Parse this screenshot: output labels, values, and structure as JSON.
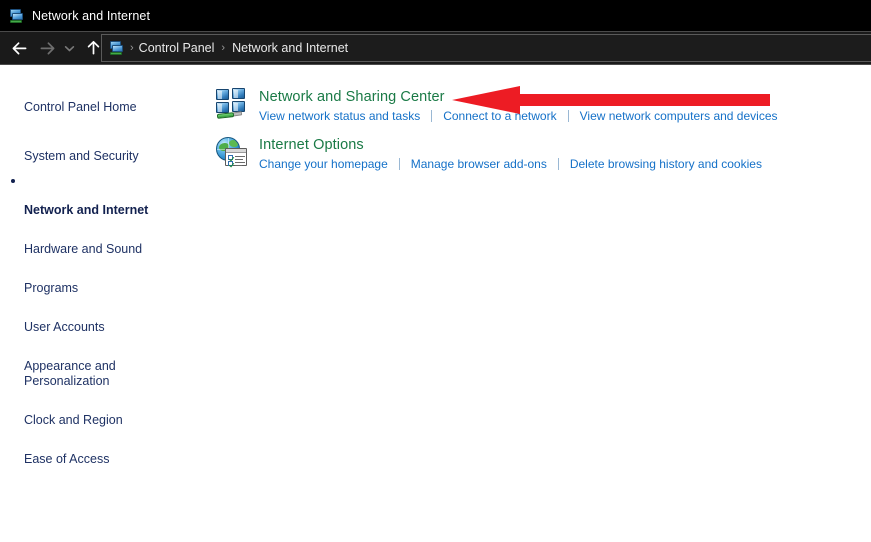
{
  "window": {
    "title": "Network and Internet",
    "title_icon": "network-icon"
  },
  "navbar": {
    "back_label": "Back",
    "forward_label": "Forward",
    "recent_label": "Recent locations",
    "up_label": "Up one level",
    "address_icon": "network-icon",
    "breadcrumb": [
      "Control Panel",
      "Network and Internet"
    ],
    "separator": "›"
  },
  "sidebar": {
    "items": [
      {
        "label": "Control Panel Home",
        "current": false,
        "spaced": true
      },
      {
        "label": "System and Security",
        "current": false,
        "spaced": false
      },
      {
        "label": "Network and Internet",
        "current": true,
        "spaced": false
      },
      {
        "label": "Hardware and Sound",
        "current": false,
        "spaced": false
      },
      {
        "label": "Programs",
        "current": false,
        "spaced": false
      },
      {
        "label": "User Accounts",
        "current": false,
        "spaced": false
      },
      {
        "label": "Appearance and\nPersonalization",
        "current": false,
        "spaced": false
      },
      {
        "label": "Clock and Region",
        "current": false,
        "spaced": false
      },
      {
        "label": "Ease of Access",
        "current": false,
        "spaced": false
      }
    ]
  },
  "content": {
    "categories": [
      {
        "icon": "network-and-sharing-center-icon",
        "title": "Network and Sharing Center",
        "links": [
          "View network status and tasks",
          "Connect to a network",
          "View network computers and devices"
        ]
      },
      {
        "icon": "internet-options-icon",
        "title": "Internet Options",
        "links": [
          "Change your homepage",
          "Manage browser add-ons",
          "Delete browsing history and cookies"
        ]
      }
    ]
  },
  "annotation": {
    "arrow": {
      "name": "red-pointer-arrow",
      "direction": "left",
      "color": "#ED1C24",
      "points_to": "Network and Sharing Center"
    }
  },
  "colors": {
    "titlebar_bg": "#000000",
    "navbar_bg": "#1a1a1a",
    "content_bg": "#ffffff",
    "category_title": "#1a7a46",
    "link": "#1571c8",
    "sidebar_text": "#1f3264",
    "annotation_red": "#ED1C24"
  }
}
